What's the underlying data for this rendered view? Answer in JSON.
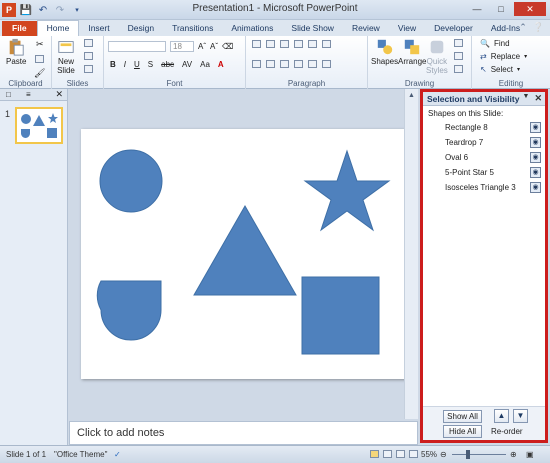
{
  "window": {
    "title": "Presentation1 - Microsoft PowerPoint"
  },
  "quick_access": {
    "icons": [
      "save-icon",
      "undo-icon",
      "redo-icon",
      "customize-qat-icon"
    ]
  },
  "tabs": [
    "File",
    "Home",
    "Insert",
    "Design",
    "Transitions",
    "Animations",
    "Slide Show",
    "Review",
    "View",
    "Developer",
    "Add-Ins"
  ],
  "ribbon": {
    "clipboard": {
      "paste_label": "Paste",
      "group_label": "Clipboard"
    },
    "slides": {
      "new_slide_label": "New",
      "new_slide_label2": "Slide",
      "group_label": "Slides"
    },
    "font": {
      "font_size": "18",
      "group_label": "Font",
      "buttons": [
        "B",
        "I",
        "U",
        "S",
        "abc",
        "AV",
        "Aa"
      ]
    },
    "paragraph": {
      "group_label": "Paragraph"
    },
    "drawing": {
      "shapes_label": "Shapes",
      "arrange_label": "Arrange",
      "quick_label": "Quick",
      "styles_label": "Styles",
      "group_label": "Drawing"
    },
    "editing": {
      "find_label": "Find",
      "replace_label": "Replace",
      "select_label": "Select",
      "group_label": "Editing"
    }
  },
  "notes_placeholder": "Click to add notes",
  "status": {
    "slide_info": "Slide 1 of 1",
    "theme": "\"Office Theme\"",
    "zoom": "55%"
  },
  "thumbnail": {
    "number": "1"
  },
  "selection_pane": {
    "title": "Selection and Visibility",
    "subtitle": "Shapes on this Slide:",
    "items": [
      {
        "name": "Rectangle 8"
      },
      {
        "name": "Teardrop 7"
      },
      {
        "name": "Oval 6"
      },
      {
        "name": "5-Point Star 5"
      },
      {
        "name": "Isosceles Triangle 3"
      }
    ],
    "show_all": "Show All",
    "hide_all": "Hide All",
    "reorder": "Re-order"
  },
  "colors": {
    "shape_fill": "#4f81bd",
    "file_tab": "#d2461f",
    "highlight_border": "#cc1d1d"
  }
}
